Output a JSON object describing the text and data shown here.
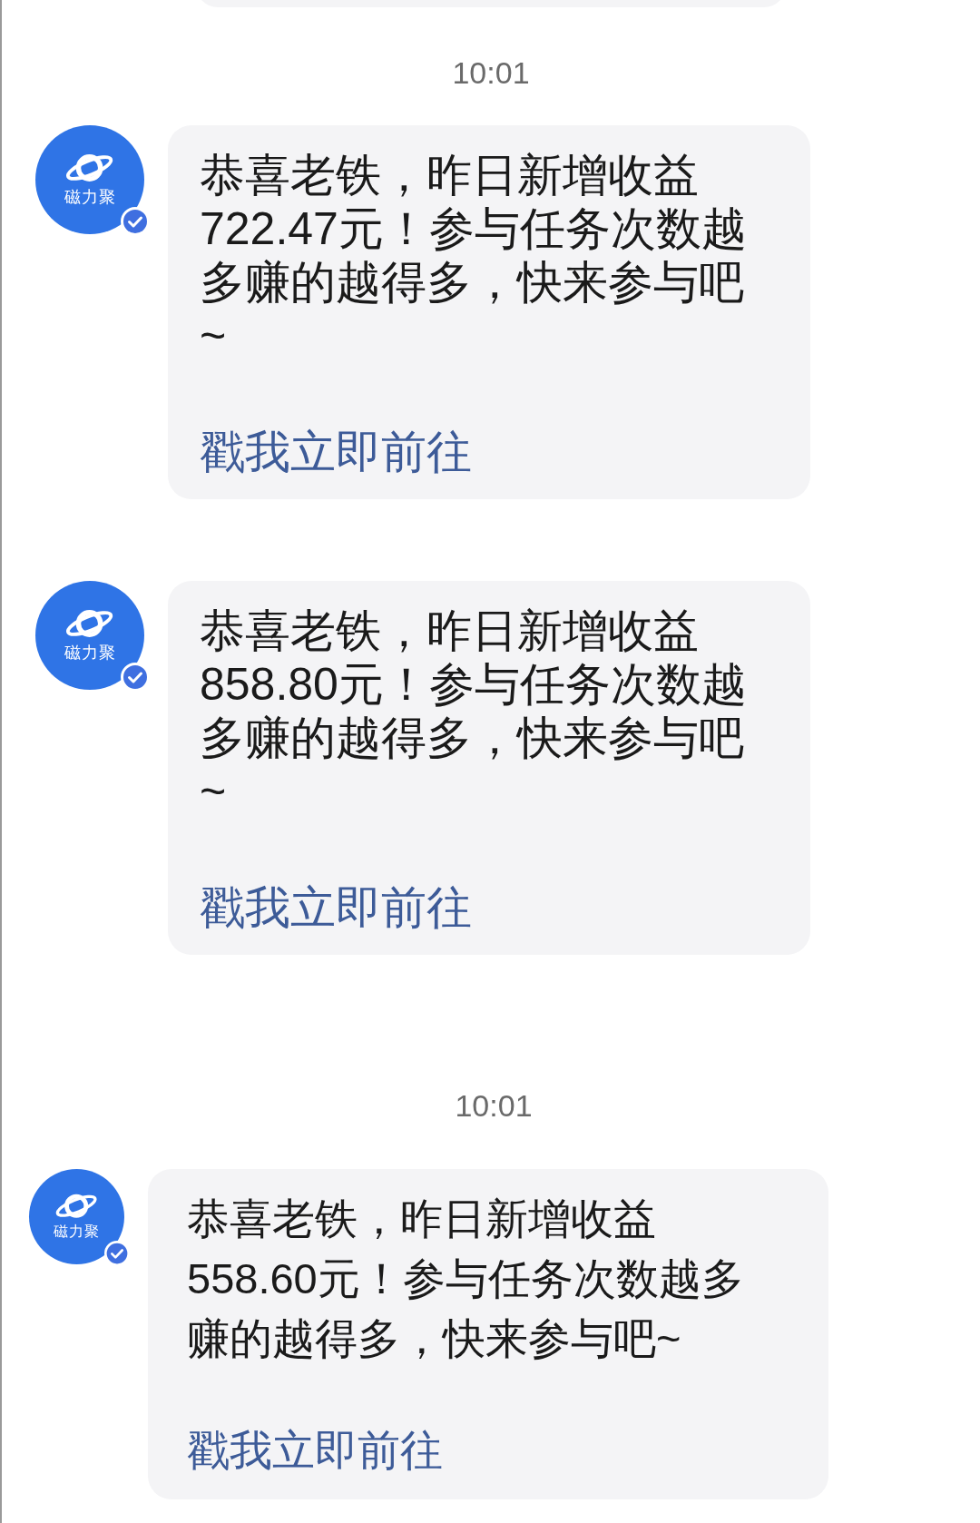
{
  "conversation": [
    {
      "kind": "time",
      "text": "10:01"
    },
    {
      "kind": "message",
      "avatar_label": "磁力聚",
      "verified": true,
      "text": "恭喜老铁，昨日新增收益722.47元！参与任务次数越多赚的越得多，快来参与吧~",
      "link": "戳我立即前往"
    },
    {
      "kind": "message",
      "avatar_label": "磁力聚",
      "verified": true,
      "text": "恭喜老铁，昨日新增收益858.80元！参与任务次数越多赚的越得多，快来参与吧~",
      "link": "戳我立即前往"
    },
    {
      "kind": "time",
      "text": "10:01"
    },
    {
      "kind": "message",
      "avatar_label": "磁力聚",
      "verified": true,
      "text": "恭喜老铁，昨日新增收益558.60元！参与任务次数越多赚的越得多，快来参与吧~",
      "link": "戳我立即前往"
    }
  ]
}
